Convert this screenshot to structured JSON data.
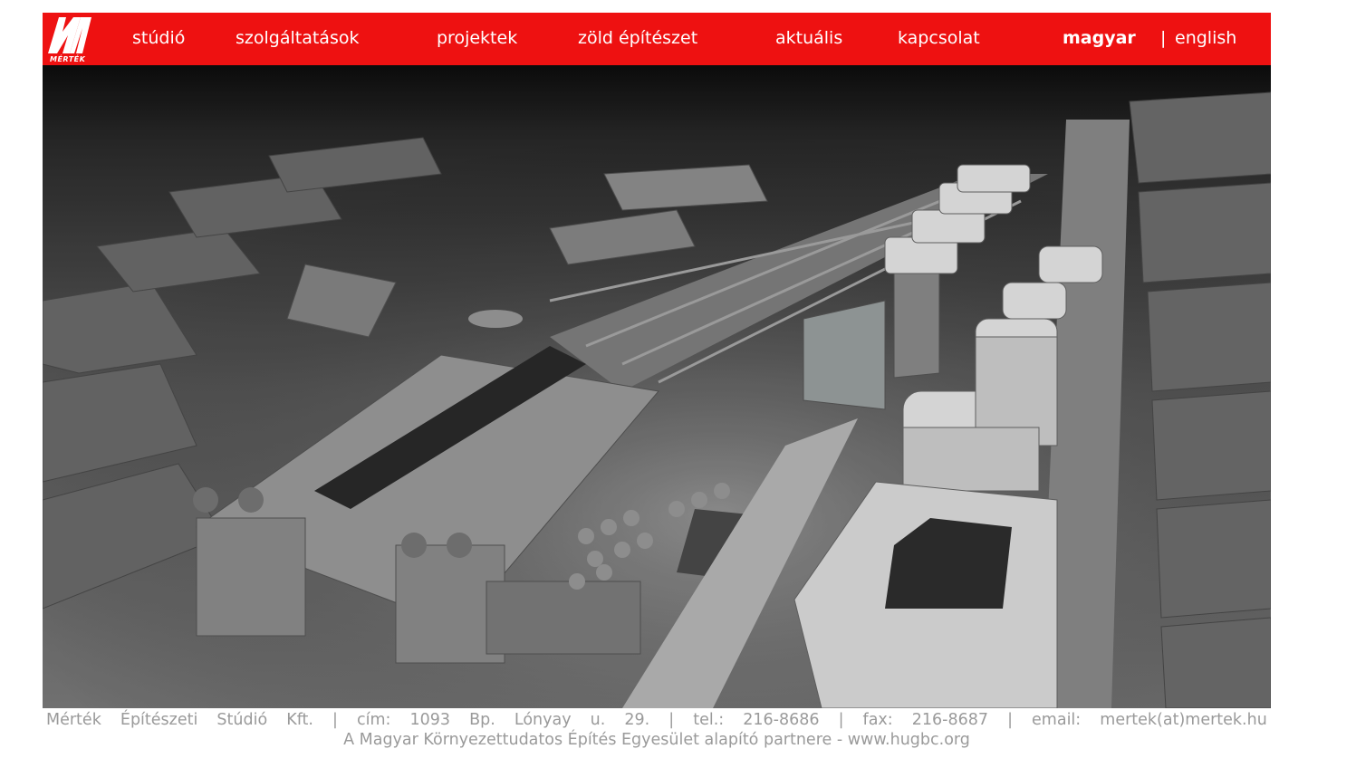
{
  "brand": {
    "logo_text": "MÉRTÉK",
    "header_color": "#ee1111"
  },
  "nav": {
    "items": [
      {
        "label": "stúdió"
      },
      {
        "label": "szolgáltatások"
      },
      {
        "label": "projektek"
      },
      {
        "label": "zöld építészet"
      },
      {
        "label": "aktuális"
      },
      {
        "label": "kapcsolat"
      }
    ],
    "languages": [
      {
        "label": "magyar",
        "active": true
      },
      {
        "label": "english",
        "active": false
      }
    ],
    "separator": "|"
  },
  "hero": {
    "image": "grayscale architectural model of railway station district"
  },
  "footer": {
    "parts": [
      "Mérték",
      "Építészeti",
      "Stúdió",
      "Kft.",
      "|",
      "cím:",
      "1093",
      "Bp.",
      "Lónyay",
      "u.",
      "29.",
      "|",
      "tel.:",
      "216-8686",
      "|",
      "fax:",
      "216-8687",
      "|",
      "email:",
      "mertek(at)mertek.hu"
    ],
    "line2": "A Magyar Környezettudatos Építés Egyesület alapító partnere - www.hugbc.org"
  }
}
